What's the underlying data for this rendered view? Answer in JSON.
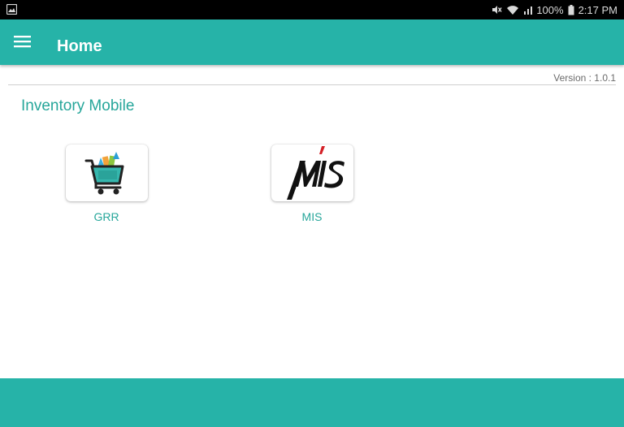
{
  "status_bar": {
    "battery": "100%",
    "time": "2:17 PM",
    "icons": [
      "gallery-icon",
      "mute-icon",
      "wifi-icon",
      "signal-icon",
      "battery-icon"
    ]
  },
  "app_bar": {
    "title": "Home",
    "menu_icon": "hamburger-menu-icon",
    "color": "#26b3a8"
  },
  "version": "Version : 1.0.1",
  "section_title": "Inventory Mobile",
  "tiles": [
    {
      "label": "GRR",
      "icon": "shopping-cart-icon"
    },
    {
      "label": "MIS",
      "icon": "mis-logo-icon"
    }
  ],
  "colors": {
    "accent": "#26a69a",
    "primary": "#26b3a8"
  }
}
